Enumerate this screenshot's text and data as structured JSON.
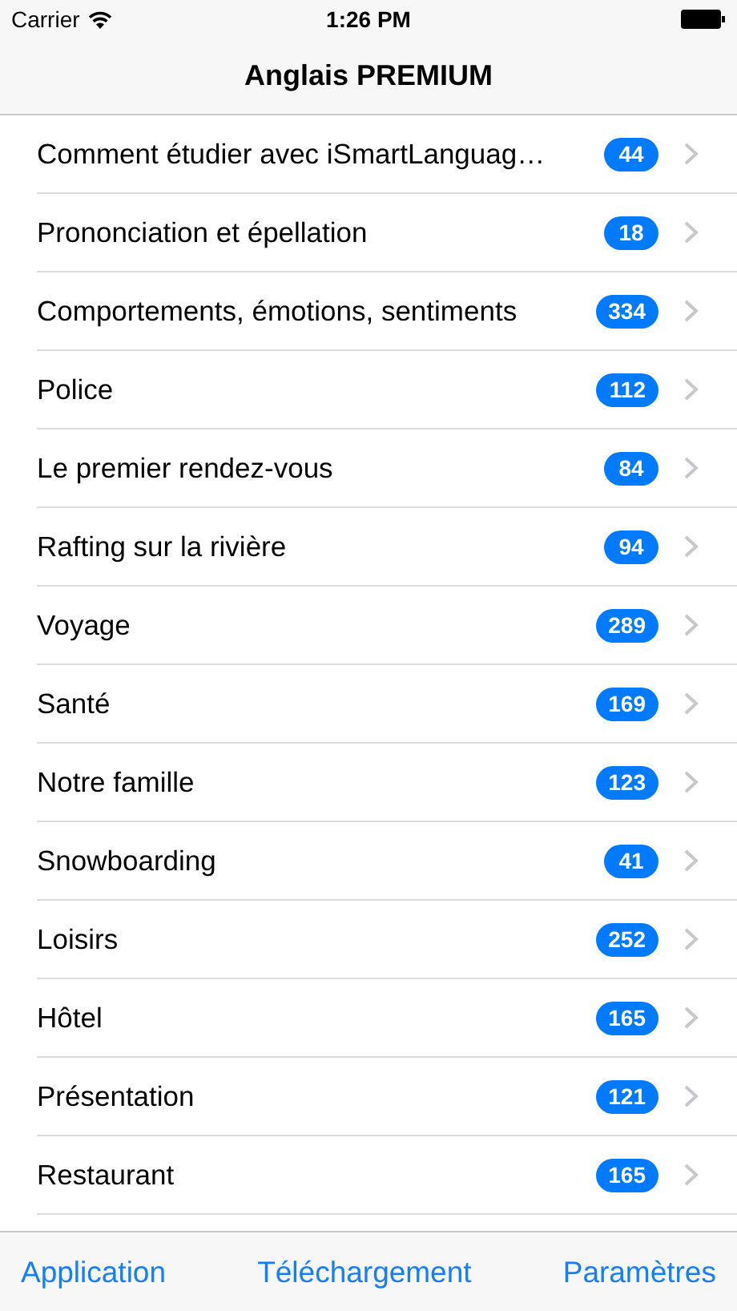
{
  "status_bar": {
    "carrier": "Carrier",
    "time": "1:26 PM"
  },
  "nav_bar": {
    "title": "Anglais PREMIUM"
  },
  "list": [
    {
      "label": "Comment étudier avec iSmartLanguag…",
      "count": "44"
    },
    {
      "label": "Prononciation et épellation",
      "count": "18"
    },
    {
      "label": "Comportements, émotions, sentiments",
      "count": "334"
    },
    {
      "label": "Police",
      "count": "112"
    },
    {
      "label": "Le premier rendez-vous",
      "count": "84"
    },
    {
      "label": "Rafting sur la rivière",
      "count": "94"
    },
    {
      "label": "Voyage",
      "count": "289"
    },
    {
      "label": "Santé",
      "count": "169"
    },
    {
      "label": "Notre famille",
      "count": "123"
    },
    {
      "label": "Snowboarding",
      "count": "41"
    },
    {
      "label": "Loisirs",
      "count": "252"
    },
    {
      "label": "Hôtel",
      "count": "165"
    },
    {
      "label": "Présentation",
      "count": "121"
    },
    {
      "label": "Restaurant",
      "count": "165"
    }
  ],
  "toolbar": [
    "Application",
    "Téléchargement",
    "Paramètres"
  ]
}
